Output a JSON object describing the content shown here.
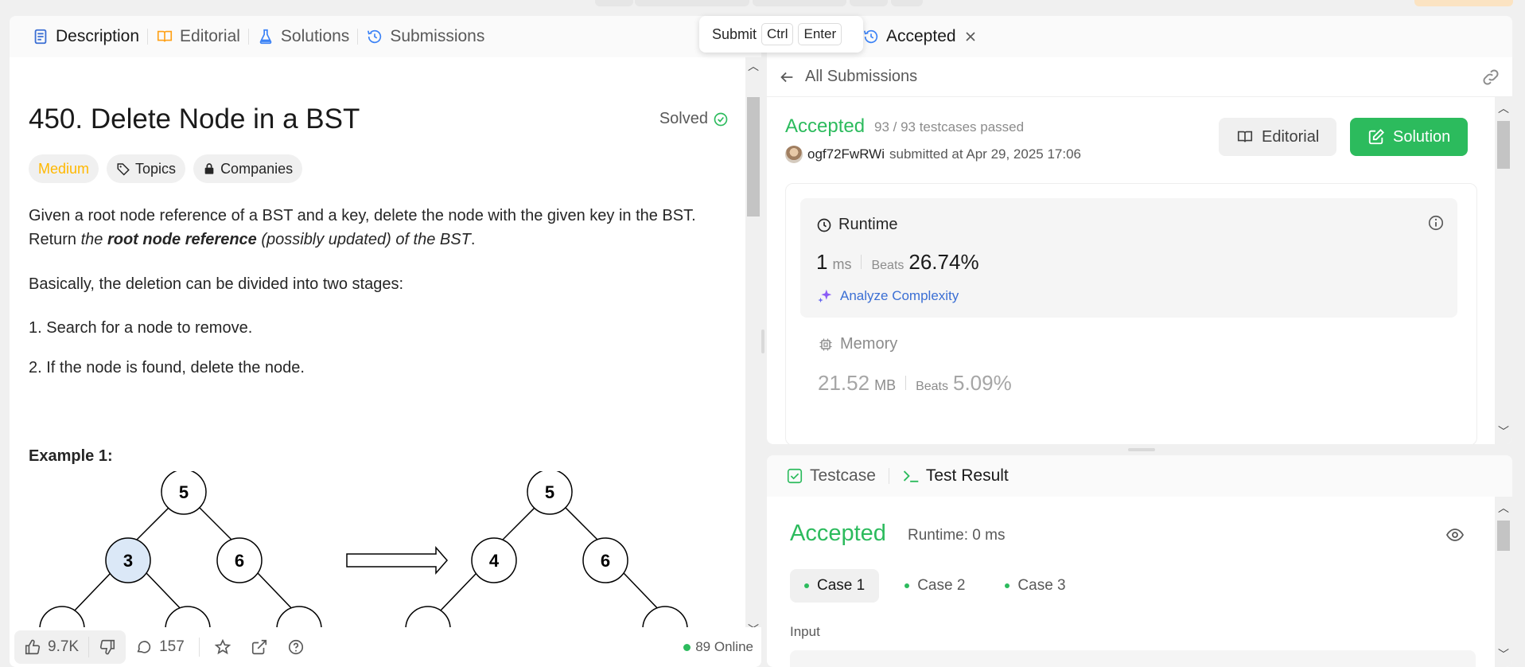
{
  "left_tabs": [
    {
      "label": "Description"
    },
    {
      "label": "Editorial"
    },
    {
      "label": "Solutions"
    },
    {
      "label": "Submissions"
    }
  ],
  "problem": {
    "title": "450. Delete Node in a BST",
    "solved_label": "Solved",
    "difficulty": "Medium",
    "topics_label": "Topics",
    "companies_label": "Companies",
    "desc_part1": "Given a root node reference of a BST and a key, delete the node with the given key in the BST. Return ",
    "desc_italic1": "the ",
    "desc_bold": "root node reference",
    "desc_italic2": " (possibly updated) of the BST",
    "desc_end": ".",
    "stages_intro": "Basically, the deletion can be divided into two stages:",
    "steps": [
      "1. Search for a node to remove.",
      "2. If the node is found, delete the node."
    ],
    "example_label": "Example 1:",
    "tree_before": [
      "5",
      "3",
      "6"
    ],
    "tree_after": [
      "5",
      "4",
      "6"
    ]
  },
  "footer": {
    "likes": "9.7K",
    "comments": "157",
    "online": "89 Online"
  },
  "popover": {
    "submit": "Submit",
    "ctrl": "Ctrl",
    "enter": "Enter"
  },
  "submission": {
    "tab_label": "Accepted",
    "back_label": "All Submissions",
    "status": "Accepted",
    "testcases": "93 / 93 testcases passed",
    "username": "ogf72FwRWi",
    "submitted_at": "submitted at Apr 29, 2025 17:06",
    "editorial_btn": "Editorial",
    "solution_btn": "Solution",
    "runtime_label": "Runtime",
    "runtime_value": "1",
    "runtime_unit": "ms",
    "beats_label": "Beats",
    "runtime_beats": "26.74%",
    "analyze_label": "Analyze Complexity",
    "memory_label": "Memory",
    "memory_value": "21.52",
    "memory_unit": "MB",
    "memory_beats": "5.09%"
  },
  "test_panel": {
    "testcase_tab": "Testcase",
    "result_tab": "Test Result",
    "status": "Accepted",
    "runtime": "Runtime: 0 ms",
    "cases": [
      "Case 1",
      "Case 2",
      "Case 3"
    ],
    "input_label": "Input"
  },
  "colors": {
    "accent_green": "#2cbb5d",
    "medium": "#ffb800",
    "link_blue": "#3b6fd4",
    "highlight_node": "#dbe8f7"
  }
}
